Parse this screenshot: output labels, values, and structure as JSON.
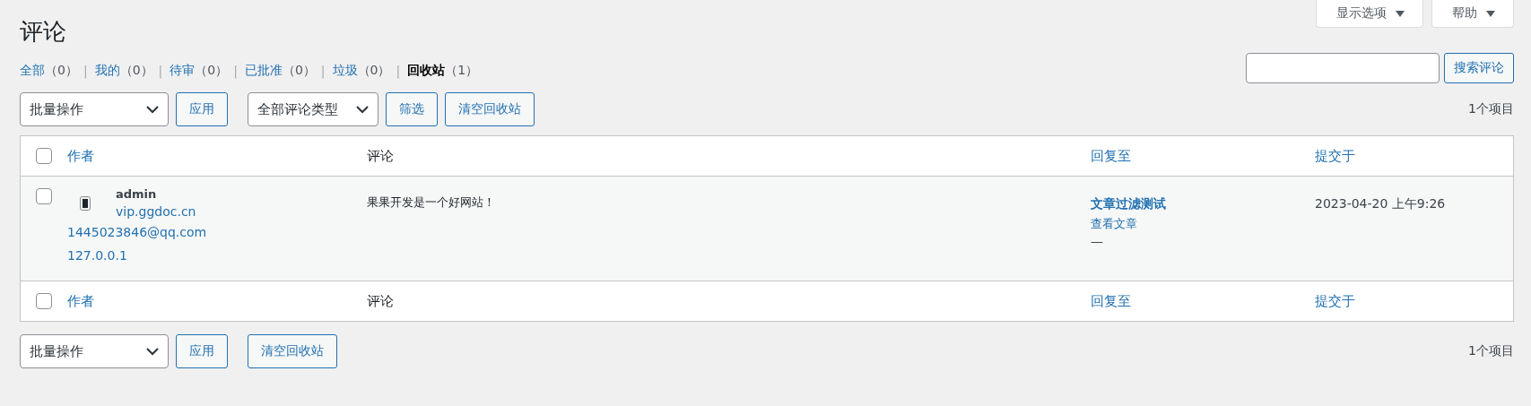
{
  "screen_meta": [
    {
      "label": "显示选项"
    },
    {
      "label": "帮助"
    }
  ],
  "title": "评论",
  "views": [
    {
      "label": "全部",
      "count": "（0）",
      "selected": false
    },
    {
      "label": "我的",
      "count": "（0）",
      "selected": false
    },
    {
      "label": "待审",
      "count": "（0）",
      "selected": false
    },
    {
      "label": "已批准",
      "count": "（0）",
      "selected": false
    },
    {
      "label": "垃圾",
      "count": "（0）",
      "selected": false
    },
    {
      "label": "回收站",
      "count": "（1）",
      "selected": true
    }
  ],
  "view_separator": "|",
  "search": {
    "button": "搜索评论"
  },
  "top_nav": {
    "bulk_action": "批量操作",
    "apply": "应用",
    "comment_type": "全部评论类型",
    "filter": "筛选",
    "empty_trash": "清空回收站",
    "count": "1个项目"
  },
  "table": {
    "columns": [
      "作者",
      "评论",
      "回复至",
      "提交于"
    ],
    "header_checked": false,
    "rows": [
      {
        "checked": false,
        "author": "admin",
        "url": "vip.ggdoc.cn",
        "email": "1445023846@qq.com",
        "ip": "127.0.0.1",
        "comment": "果果开发是一个好网站！",
        "reply_to": "文章过滤测试",
        "view_post": "查看文章",
        "reply_meta": "—",
        "submitted": "2023-04-20 上午9:26"
      }
    ],
    "footer_columns": [
      "作者",
      "评论",
      "回复至",
      "提交于"
    ],
    "footer_checked": false
  },
  "bottom_nav": {
    "bulk_action": "批量操作",
    "apply": "应用",
    "empty_trash": "清空回收站",
    "count": "1个项目"
  }
}
